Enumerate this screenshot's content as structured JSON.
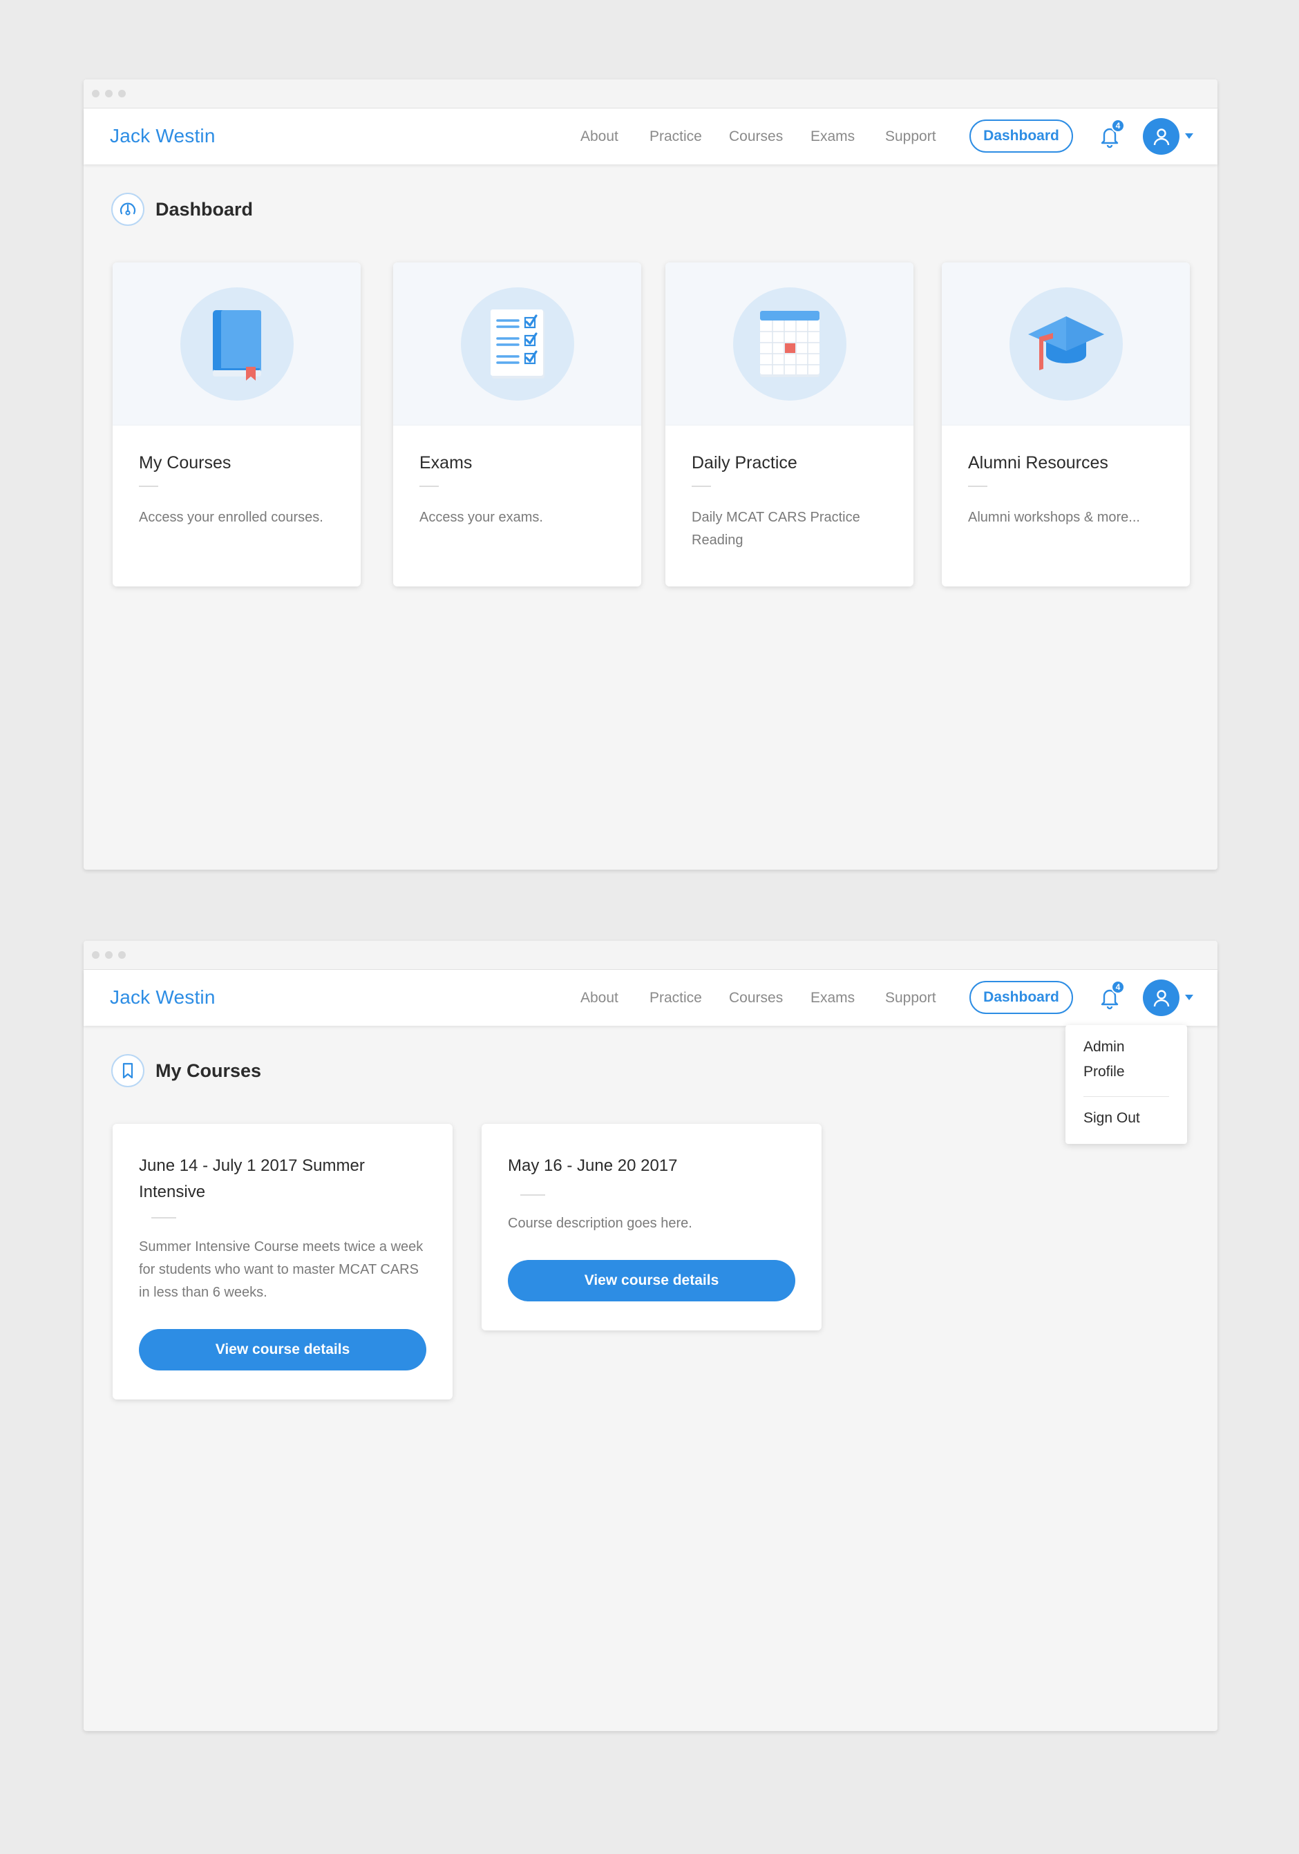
{
  "windows": [
    {
      "brand": "Jack Westin",
      "nav": {
        "about": "About",
        "practice": "Practice",
        "courses": "Courses",
        "exams": "Exams",
        "support": "Support",
        "dashboard": "Dashboard"
      },
      "notification_count": "4",
      "page_title": "Dashboard",
      "cards": [
        {
          "title": "My Courses",
          "description": "Access your enrolled courses."
        },
        {
          "title": "Exams",
          "description": "Access your exams."
        },
        {
          "title": "Daily Practice",
          "description": "Daily MCAT CARS Practice Reading"
        },
        {
          "title": "Alumni Resources",
          "description": "Alumni workshops & more..."
        }
      ]
    },
    {
      "brand": "Jack Westin",
      "nav": {
        "about": "About",
        "practice": "Practice",
        "courses": "Courses",
        "exams": "Exams",
        "support": "Support",
        "dashboard": "Dashboard"
      },
      "notification_count": "4",
      "page_title": "My Courses",
      "courses": [
        {
          "title": "June 14 - July 1 2017 Summer Intensive",
          "description": "Summer Intensive Course meets twice a week for students who want to master MCAT CARS in less than 6 weeks.",
          "button": "View course details"
        },
        {
          "title": "May 16 - June 20 2017",
          "description": "Course description goes here.",
          "button": "View course details"
        }
      ],
      "user_menu": {
        "admin_profile": "Admin Profile",
        "sign_out": "Sign Out"
      }
    }
  ],
  "colors": {
    "accent": "#2d8de4",
    "background": "#ebebeb",
    "window_bg": "#f5f5f5",
    "card_icon_circle": "#dbeaf8",
    "bookmark_red": "#ec6b62"
  },
  "icons": {
    "dashboard_page": "gauge-icon",
    "courses_page": "bookmark-icon",
    "notifications": "bell-icon",
    "user": "user-icon",
    "card_1": "book-icon",
    "card_2": "checklist-icon",
    "card_3": "calendar-icon",
    "card_4": "graduation-cap-icon"
  }
}
